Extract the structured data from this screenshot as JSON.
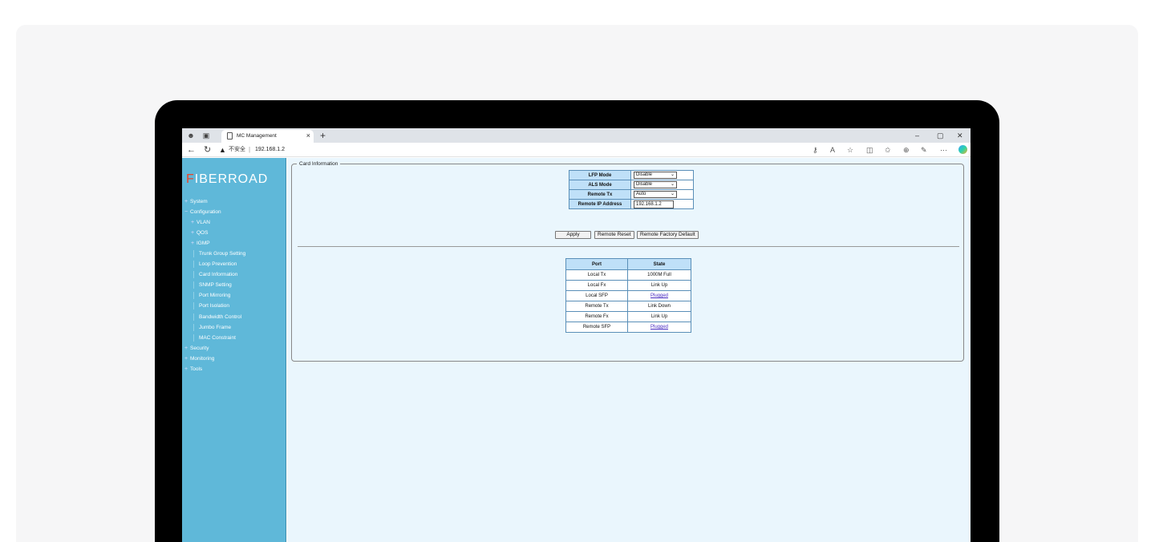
{
  "browser": {
    "tab_title": "MC Management",
    "tab_close": "×",
    "new_tab": "+",
    "security_label": "不安全",
    "separator": "|",
    "url": "192.168.1.2",
    "window_controls": {
      "minimize": "–",
      "restore": "▢",
      "close": "✕"
    }
  },
  "sidebar": {
    "logo": "FIBERROAD",
    "items": [
      {
        "label": "System",
        "marker": "+"
      },
      {
        "label": "Configuration",
        "marker": "−"
      },
      {
        "label": "VLAN",
        "marker": "+"
      },
      {
        "label": "QOS",
        "marker": "+"
      },
      {
        "label": "IGMP",
        "marker": "+"
      },
      {
        "label": "Trunk Group Setting"
      },
      {
        "label": "Loop Prevention"
      },
      {
        "label": "Card Information"
      },
      {
        "label": "SNMP Setting"
      },
      {
        "label": "Port Mirroring"
      },
      {
        "label": "Port Isolation"
      },
      {
        "label": "Bandwidth Control"
      },
      {
        "label": "Jumbo Frame"
      },
      {
        "label": "MAC Constraint"
      },
      {
        "label": "Security",
        "marker": "+"
      },
      {
        "label": "Monitoring",
        "marker": "+"
      },
      {
        "label": "Tools",
        "marker": "+"
      }
    ]
  },
  "card_info": {
    "legend": "Card Information",
    "settings": [
      {
        "label": "LFP Mode",
        "value": "Disable"
      },
      {
        "label": "ALS Mode",
        "value": "Disable"
      },
      {
        "label": "Remote Tx",
        "value": "Auto"
      },
      {
        "label": "Remote IP Address",
        "value": "192.168.1.2"
      }
    ],
    "buttons": {
      "apply": "Apply",
      "remote_reset": "Remote Reset",
      "remote_factory_default": "Remote Factory Default"
    },
    "status_headers": {
      "port": "Port",
      "state": "State"
    },
    "status_rows": [
      {
        "port": "Local Tx",
        "state": "1000M Full"
      },
      {
        "port": "Local Fx",
        "state": "Link Up"
      },
      {
        "port": "Local SFP",
        "state": "Plugged"
      },
      {
        "port": "Remote Tx",
        "state": "Link Down"
      },
      {
        "port": "Remote Fx",
        "state": "Link Up"
      },
      {
        "port": "Remote SFP",
        "state": "Plugged"
      }
    ]
  }
}
